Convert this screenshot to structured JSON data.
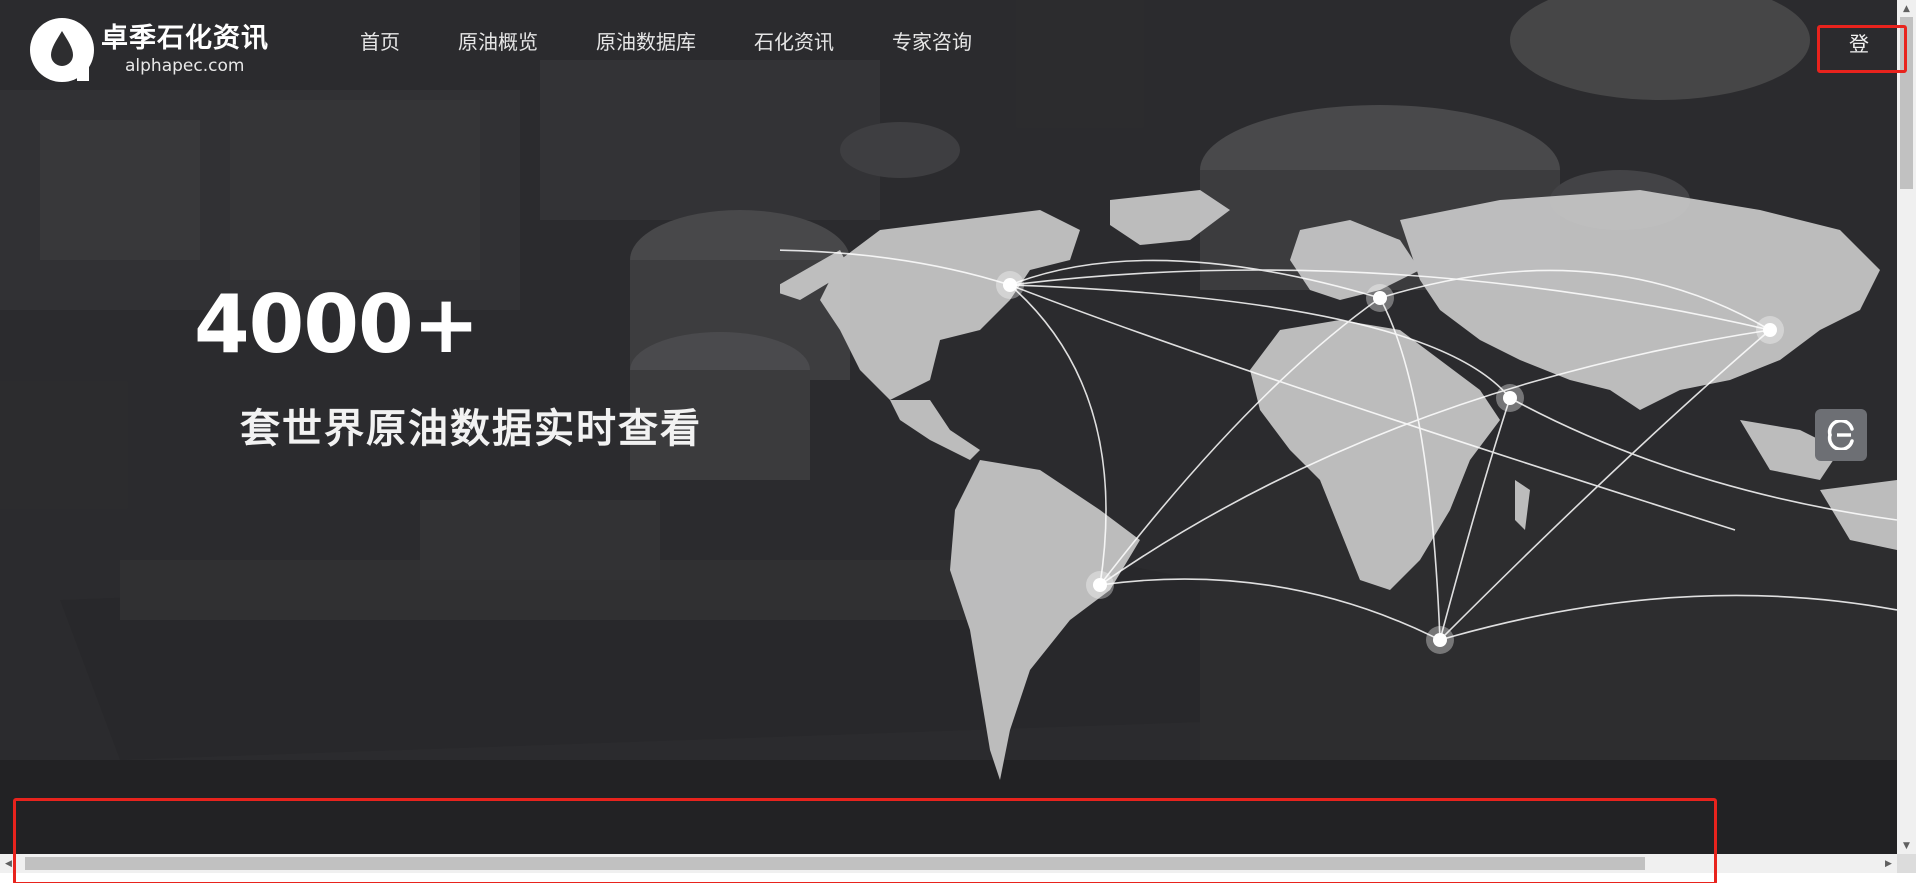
{
  "header": {
    "logo": {
      "name_cn": "卓季石化资讯",
      "domain": "alphapec.com"
    },
    "nav": [
      {
        "label": "首页"
      },
      {
        "label": "原油概览"
      },
      {
        "label": "原油数据库"
      },
      {
        "label": "石化资讯"
      },
      {
        "label": "专家咨询"
      }
    ],
    "login_label": "登"
  },
  "hero": {
    "headline": "4000+",
    "subheadline": "套世界原油数据实时查看"
  },
  "float_button": {
    "icon": "e-logo-icon"
  },
  "colors": {
    "highlight": "#e8231d",
    "float_button": "#6d6f74",
    "map_land": "#c9c9c9"
  }
}
